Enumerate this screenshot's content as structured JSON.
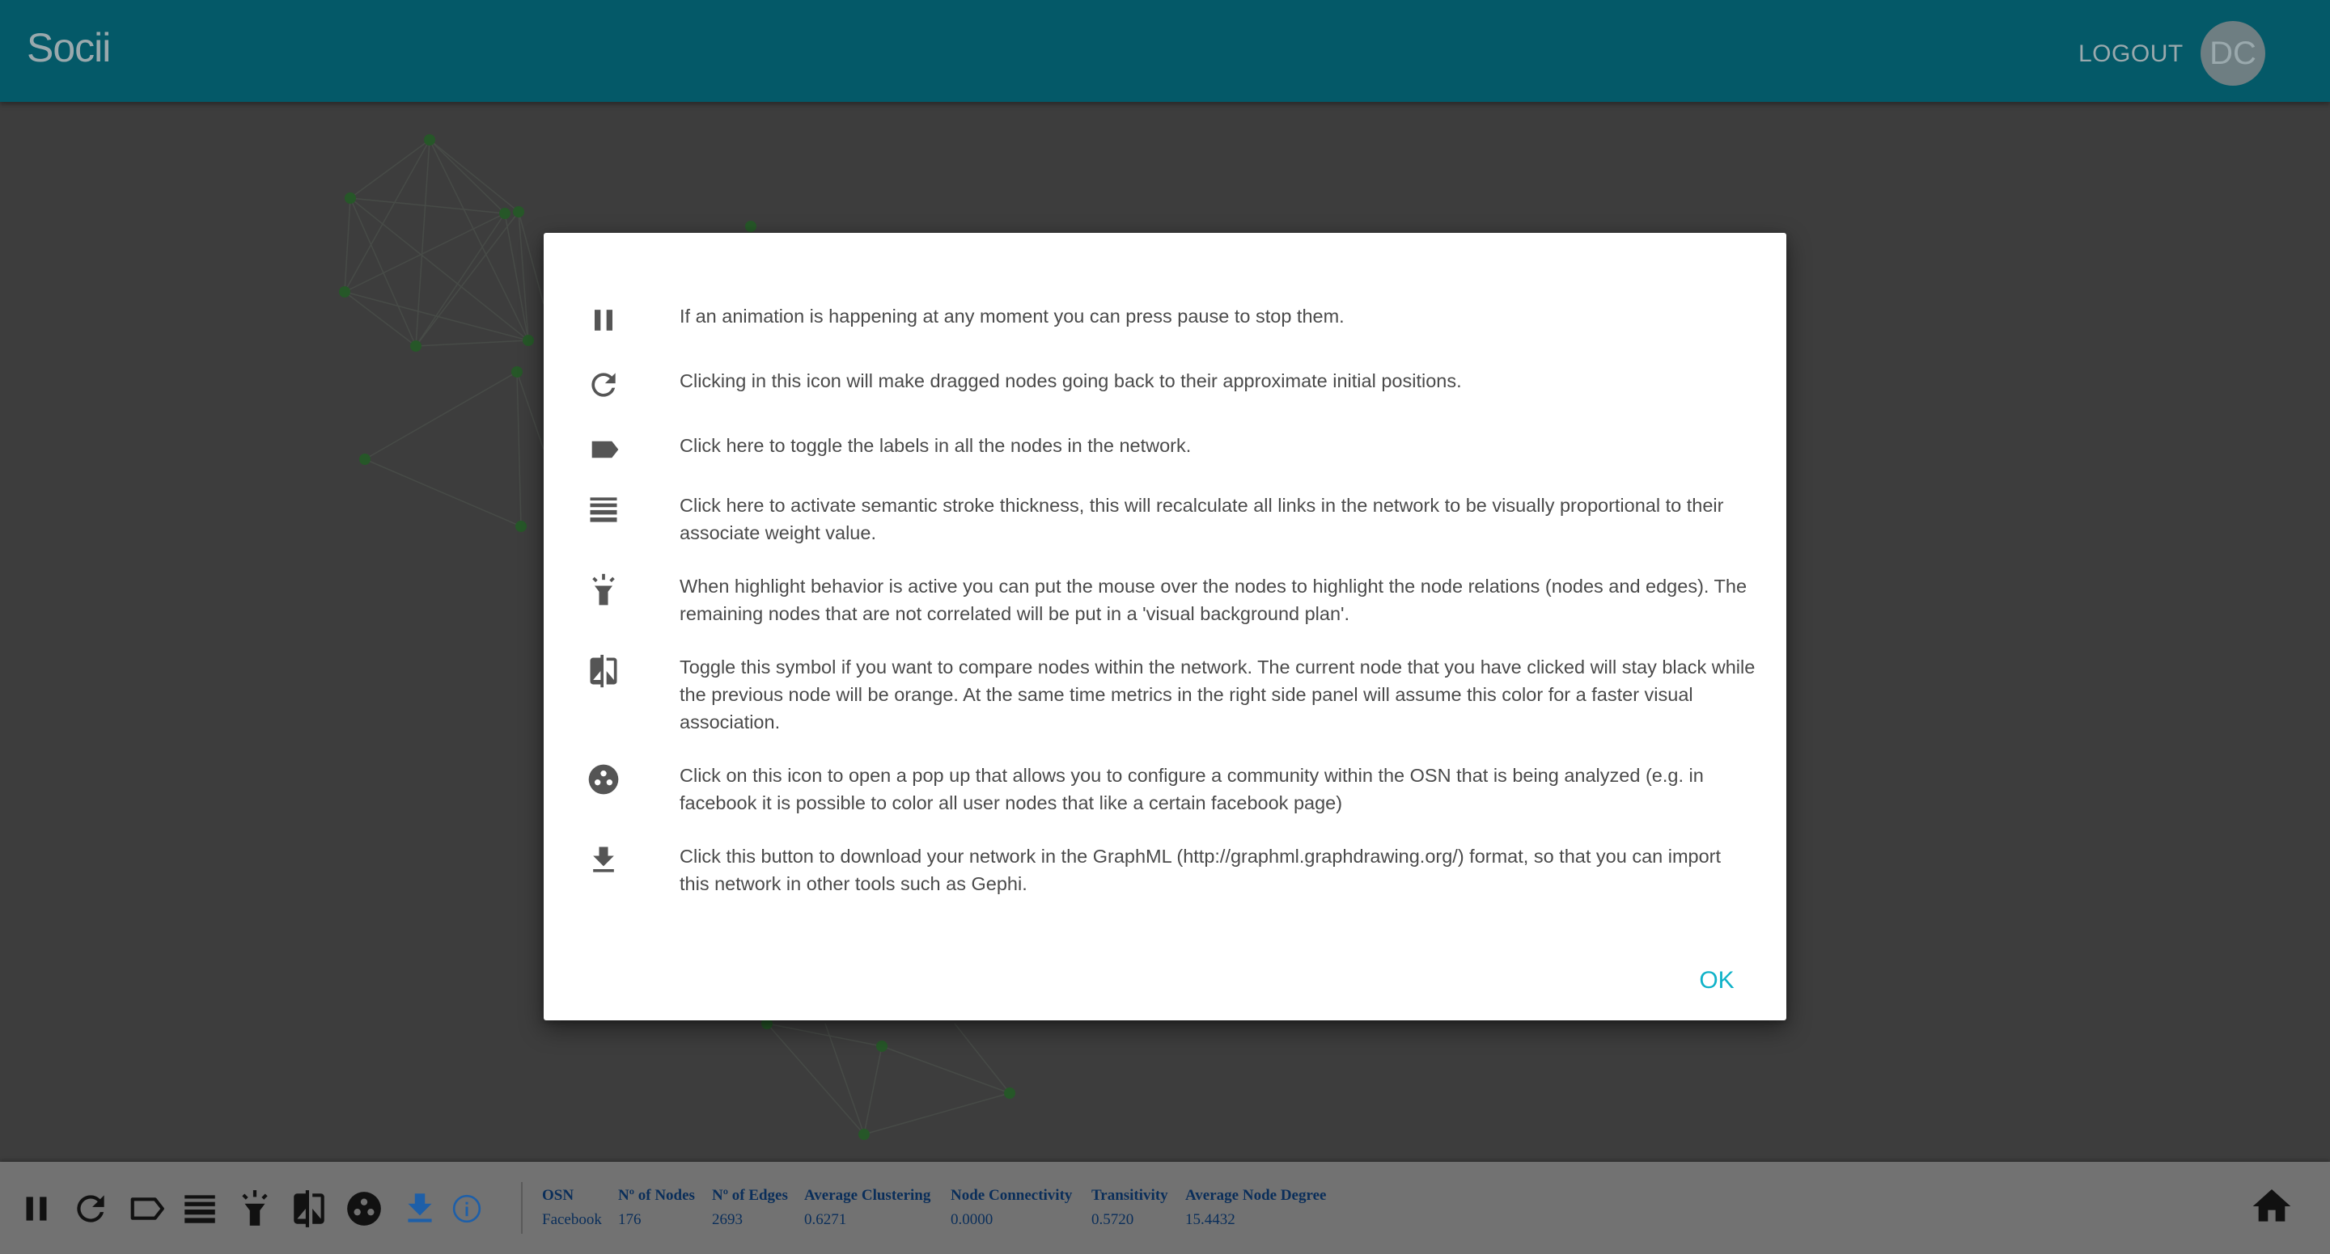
{
  "header": {
    "brand": "Socii",
    "logout_label": "LOGOUT",
    "avatar_initials": "DC"
  },
  "dialog": {
    "items": [
      {
        "icon": "pause-icon",
        "text": "If an animation is happening at any moment you can press pause to stop them."
      },
      {
        "icon": "refresh-icon",
        "text": "Clicking in this icon will make dragged nodes going back to their approximate initial positions."
      },
      {
        "icon": "label-icon",
        "text": "Click here to toggle the labels in all the nodes in the network."
      },
      {
        "icon": "stroke-thickness-icon",
        "text": "Click here to activate semantic stroke thickness, this will recalculate all links in the network to be visually proportional to their associate weight value."
      },
      {
        "icon": "highlight-icon",
        "text": "When highlight behavior is active you can put the mouse over the nodes to highlight the node relations (nodes and edges). The remaining nodes that are not correlated will be put in a 'visual background plan'."
      },
      {
        "icon": "compare-icon",
        "text": "Toggle this symbol if you want to compare nodes within the network. The current node that you have clicked will stay black while the previous node will be orange. At the same time metrics in the right side panel will assume this color for a faster visual association."
      },
      {
        "icon": "community-icon",
        "text": "Click on this icon to open a pop up that allows you to configure a community within the OSN that is being analyzed (e.g. in facebook it is possible to color all user nodes that like a certain facebook page)"
      },
      {
        "icon": "download-icon",
        "text": "Click this button to download your network in the GraphML (http://graphml.graphdrawing.org/) format, so that you can import this network in other tools such as Gephi."
      }
    ],
    "ok_label": "OK"
  },
  "toolbar": {
    "icons": [
      "pause-icon",
      "refresh-icon",
      "label-icon",
      "stroke-thickness-icon",
      "highlight-icon",
      "compare-icon",
      "community-icon",
      "download-icon",
      "info-icon"
    ],
    "active_color": "#1e5fa8",
    "home_icon": "home-icon"
  },
  "metrics": [
    {
      "label": "OSN",
      "value": "Facebook"
    },
    {
      "label": "Nº of Nodes",
      "value": "176"
    },
    {
      "label": "Nº of Edges",
      "value": "2693"
    },
    {
      "label": "Average Clustering",
      "value": "0.6271"
    },
    {
      "label": "Node Connectivity",
      "value": "0.0000"
    },
    {
      "label": "Transitivity",
      "value": "0.5720"
    },
    {
      "label": "Average Node Degree",
      "value": "15.4432"
    }
  ],
  "colors": {
    "appbar": "#045968",
    "node": "#4caf50",
    "accent": "#0fb2c8"
  }
}
